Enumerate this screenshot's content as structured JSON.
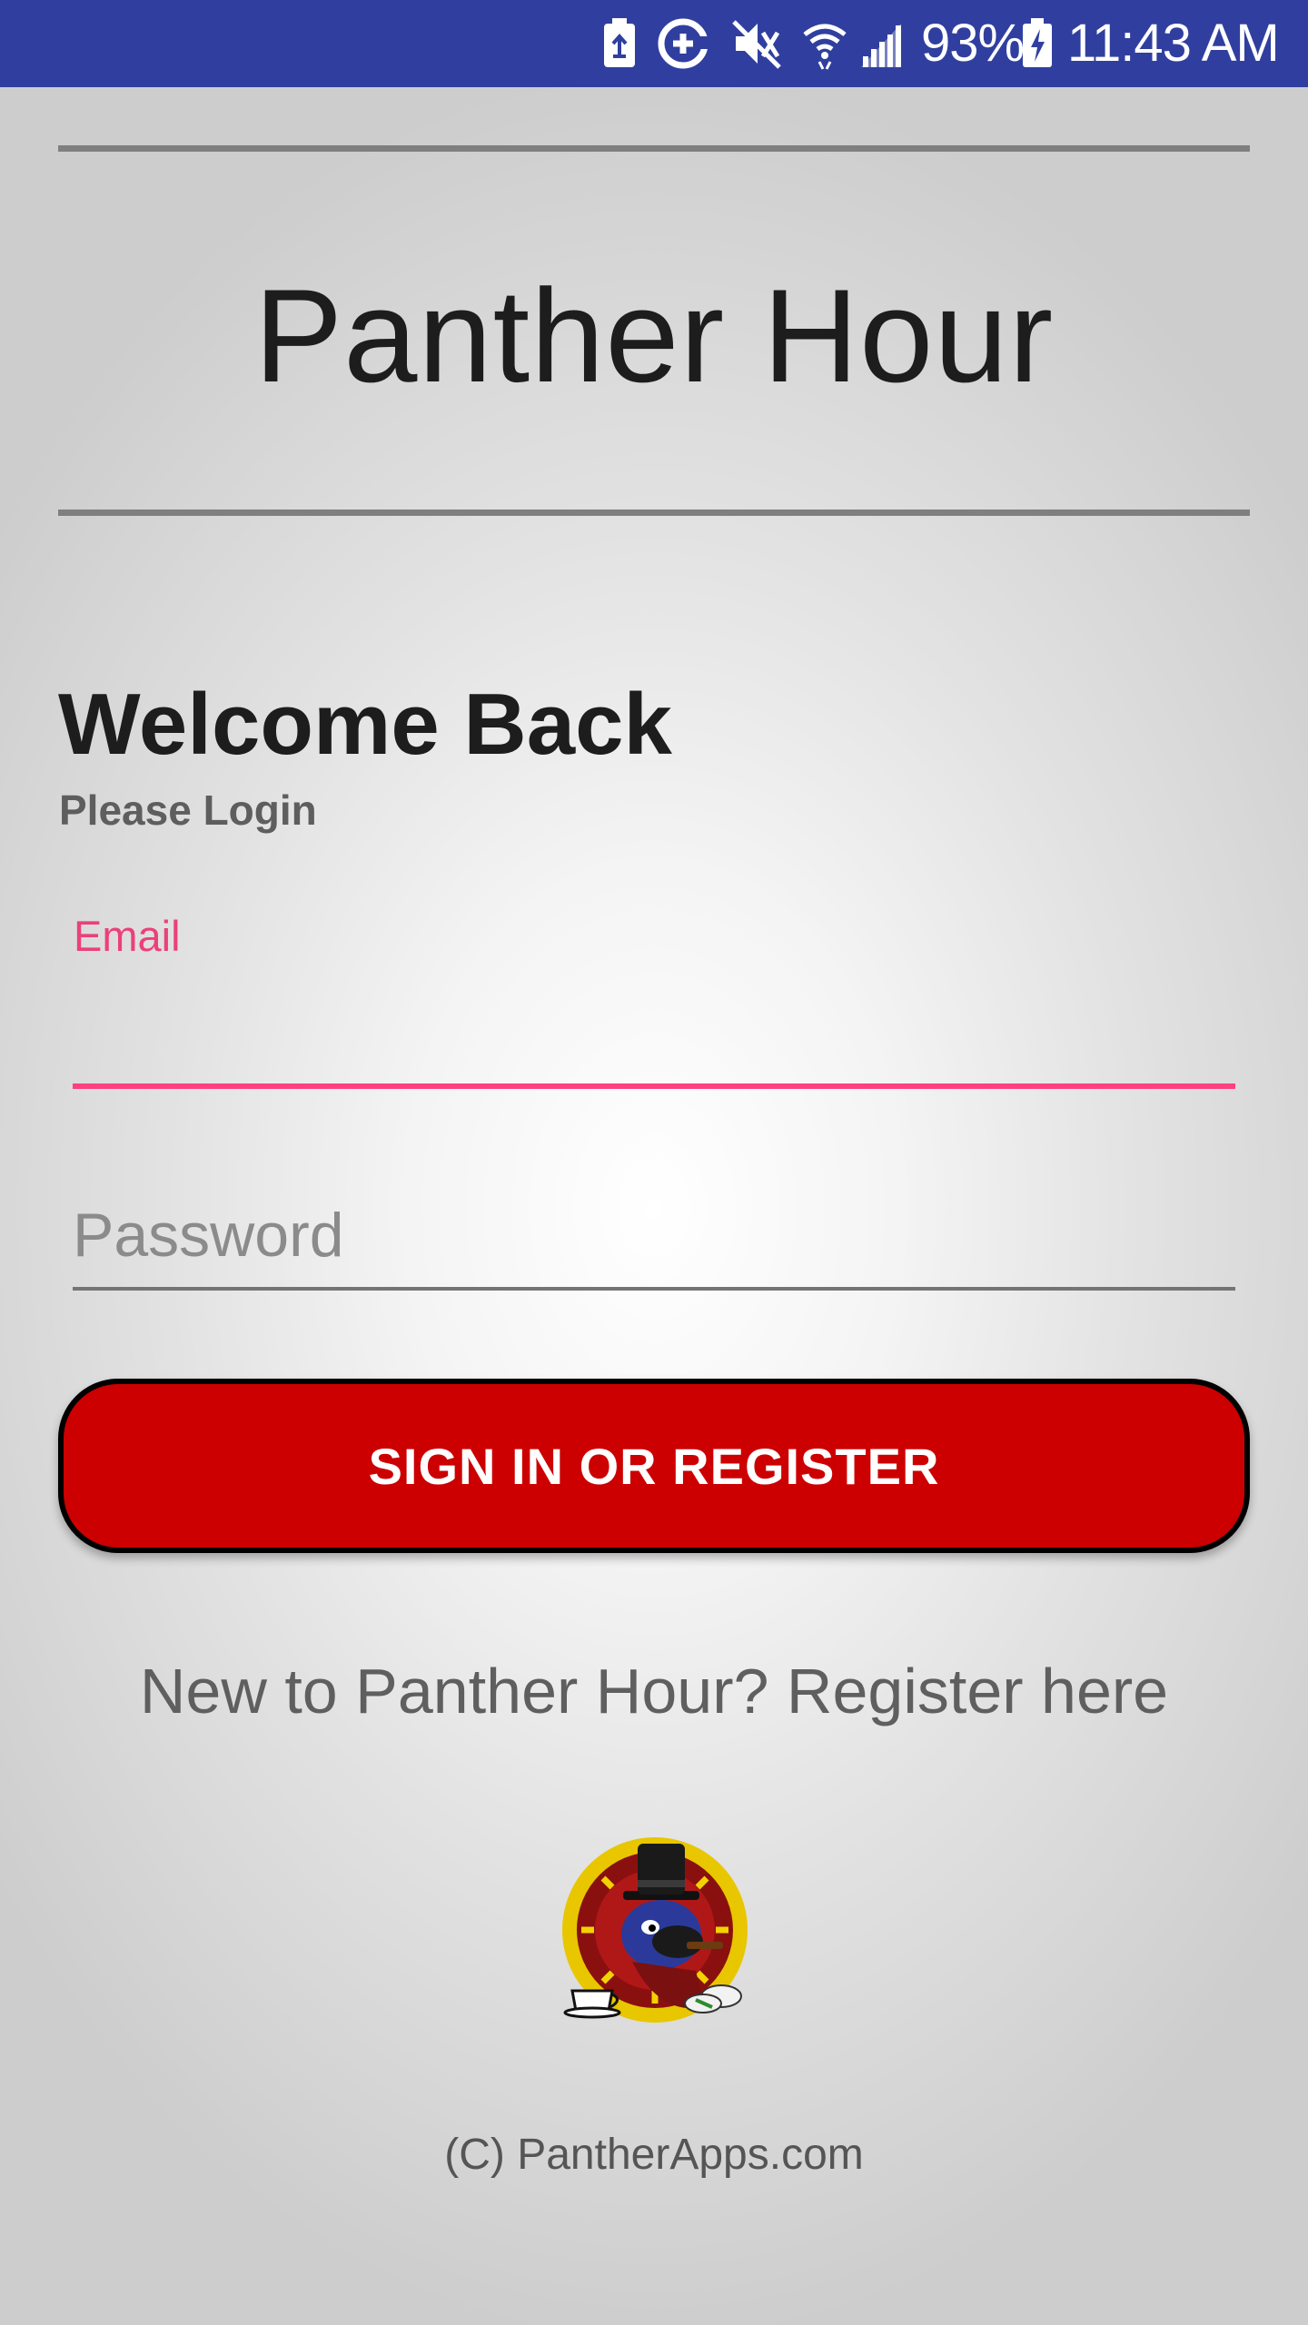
{
  "status_bar": {
    "icons": [
      "battery-saver-icon",
      "data-saver-icon",
      "mute-icon",
      "wifi-icon",
      "cell-signal-icon",
      "battery-charging-icon"
    ],
    "battery_percent": "93%",
    "time": "11:43 AM",
    "background": "#303f9f"
  },
  "app": {
    "title": "Panther Hour"
  },
  "welcome": {
    "heading": "Welcome Back",
    "subheading": "Please Login"
  },
  "form": {
    "email": {
      "label": "Email",
      "value": "",
      "accent": "#ff4081"
    },
    "password": {
      "placeholder": "Password",
      "value": ""
    },
    "submit_label": "SIGN IN OR REGISTER",
    "submit_color": "#cc0000"
  },
  "register_link": "New to Panther Hour? Register here",
  "footer": {
    "logo_icon": "panther-clock-logo",
    "copyright": "(C) PantherApps.com"
  }
}
